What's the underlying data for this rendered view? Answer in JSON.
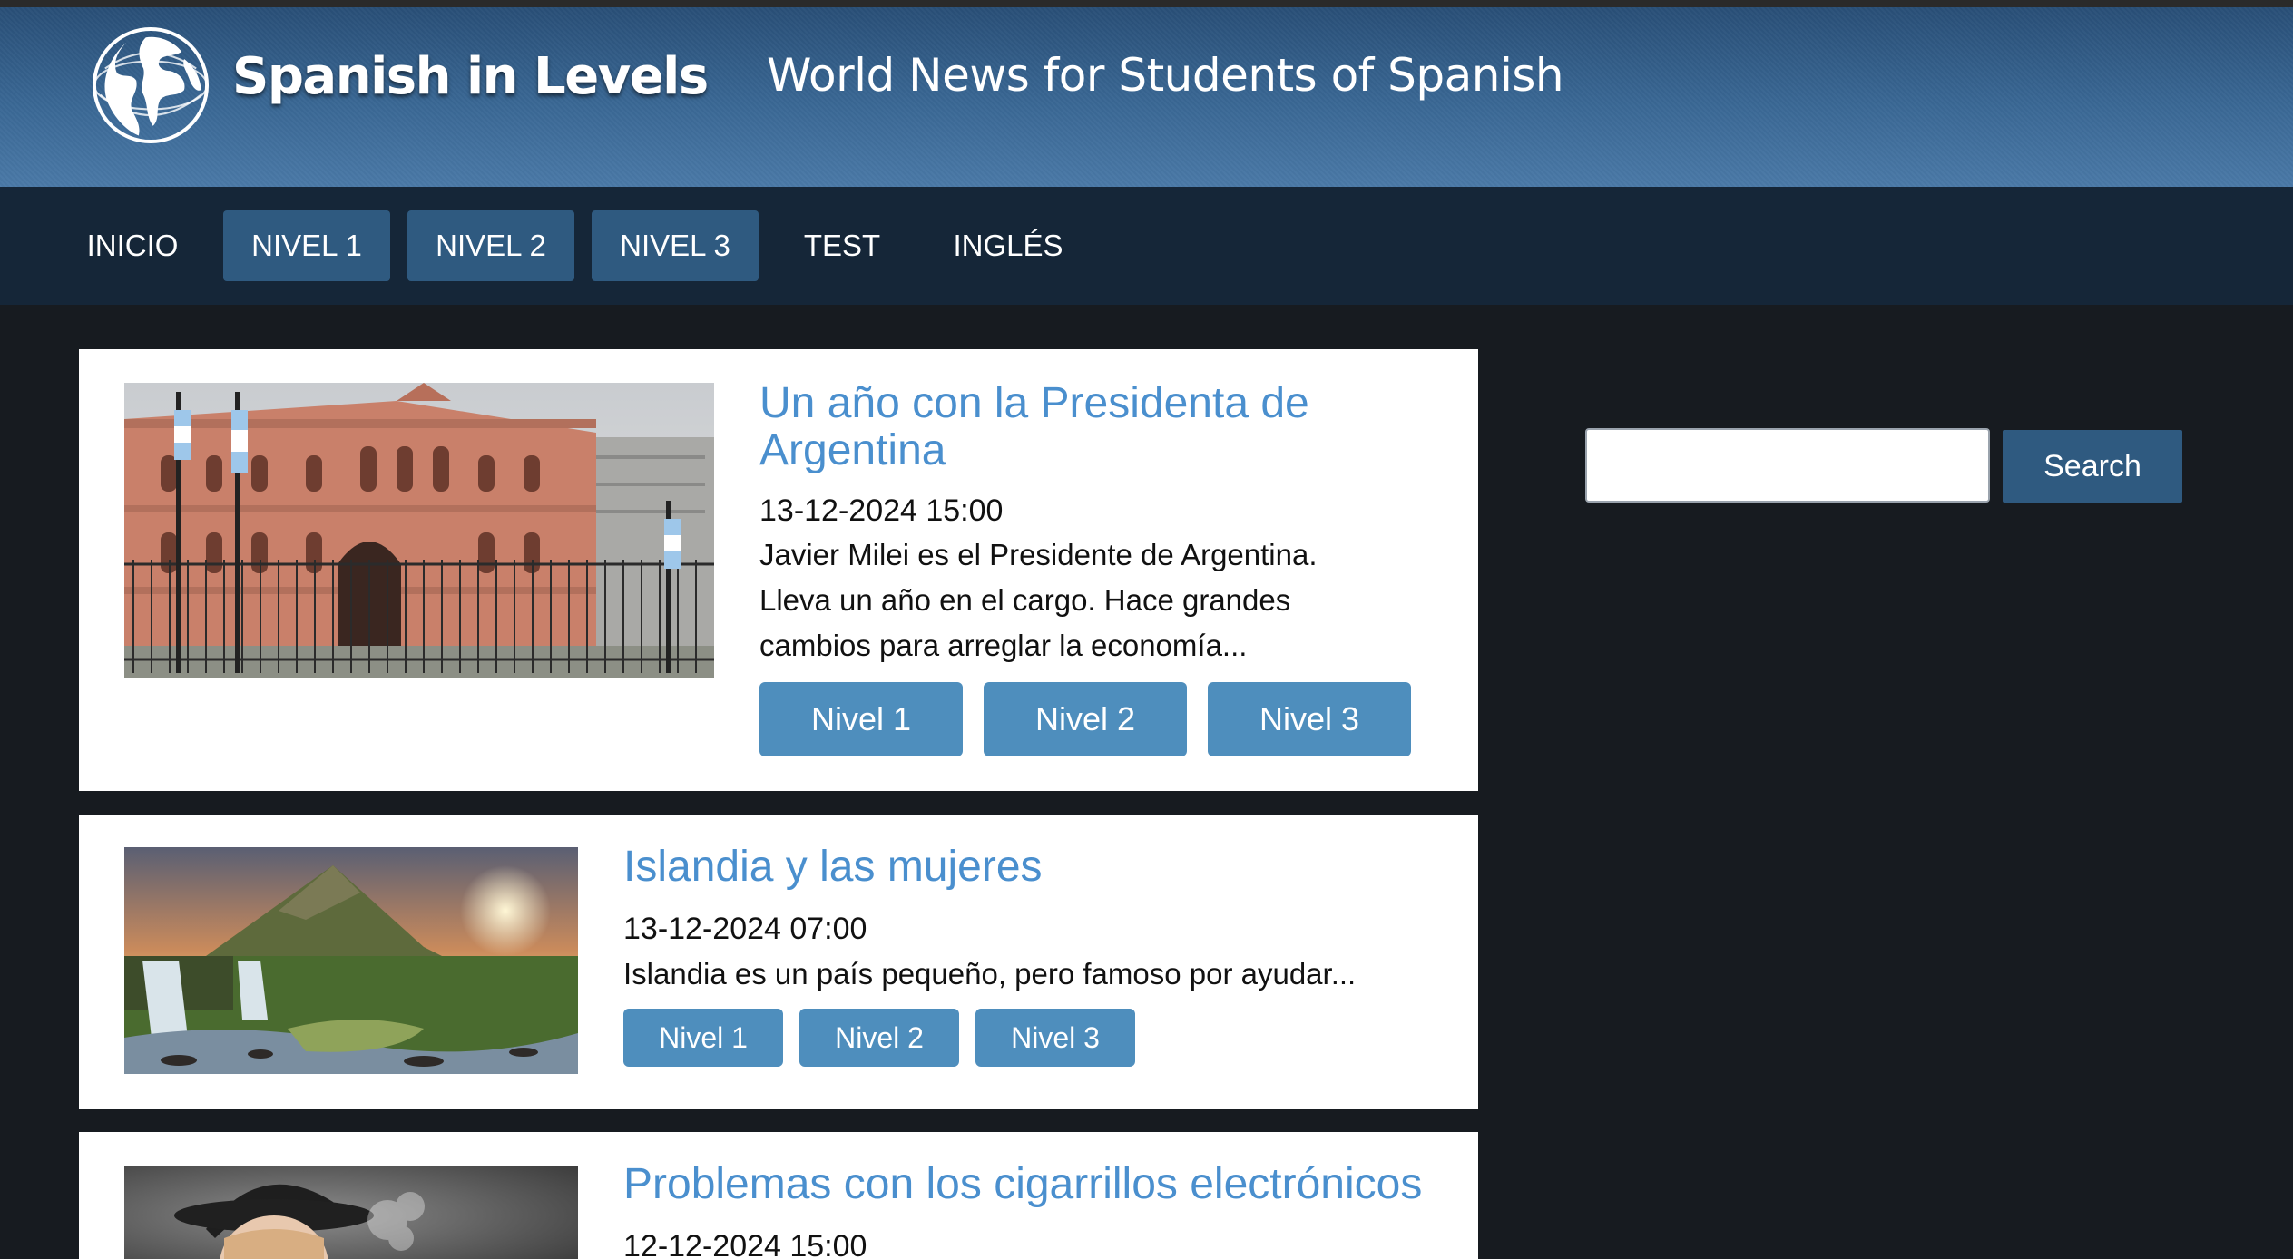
{
  "site": {
    "brand": "Spanish in Levels",
    "tagline": "World News for Students of Spanish",
    "logo_icon": "globe-icon"
  },
  "nav": {
    "items": [
      {
        "label": "INICIO"
      },
      {
        "label": "NIVEL 1"
      },
      {
        "label": "NIVEL 2"
      },
      {
        "label": "NIVEL 3"
      },
      {
        "label": "TEST"
      },
      {
        "label": "INGLÉS"
      }
    ]
  },
  "articles": [
    {
      "title_lines": [
        "Un año con la Presidenta de",
        "Argentina"
      ],
      "date": "13-12-2024 15:00",
      "excerpt_lines": [
        "Javier Milei es el Presidente de Argentina.",
        "Lleva un año en el cargo. Hace grandes",
        "cambios para arreglar la economía..."
      ],
      "levels": [
        "Nivel 1",
        "Nivel 2",
        "Nivel 3"
      ]
    },
    {
      "title_lines": [
        "Islandia y las mujeres"
      ],
      "date": "13-12-2024 07:00",
      "excerpt_lines": [
        "Islandia es un país pequeño, pero famoso por ayudar..."
      ],
      "levels": [
        "Nivel 1",
        "Nivel 2",
        "Nivel 3"
      ]
    },
    {
      "title_lines": [
        "Problemas con los cigarrillos electrónicos"
      ],
      "date": "12-12-2024 15:00"
    }
  ],
  "search": {
    "value": "",
    "button_label": "Search"
  },
  "colors": {
    "background": "#171b20",
    "nav": "#152638",
    "accent": "#2f5a80",
    "level_button": "#4e8ebd",
    "title_link": "#4a8fce"
  }
}
